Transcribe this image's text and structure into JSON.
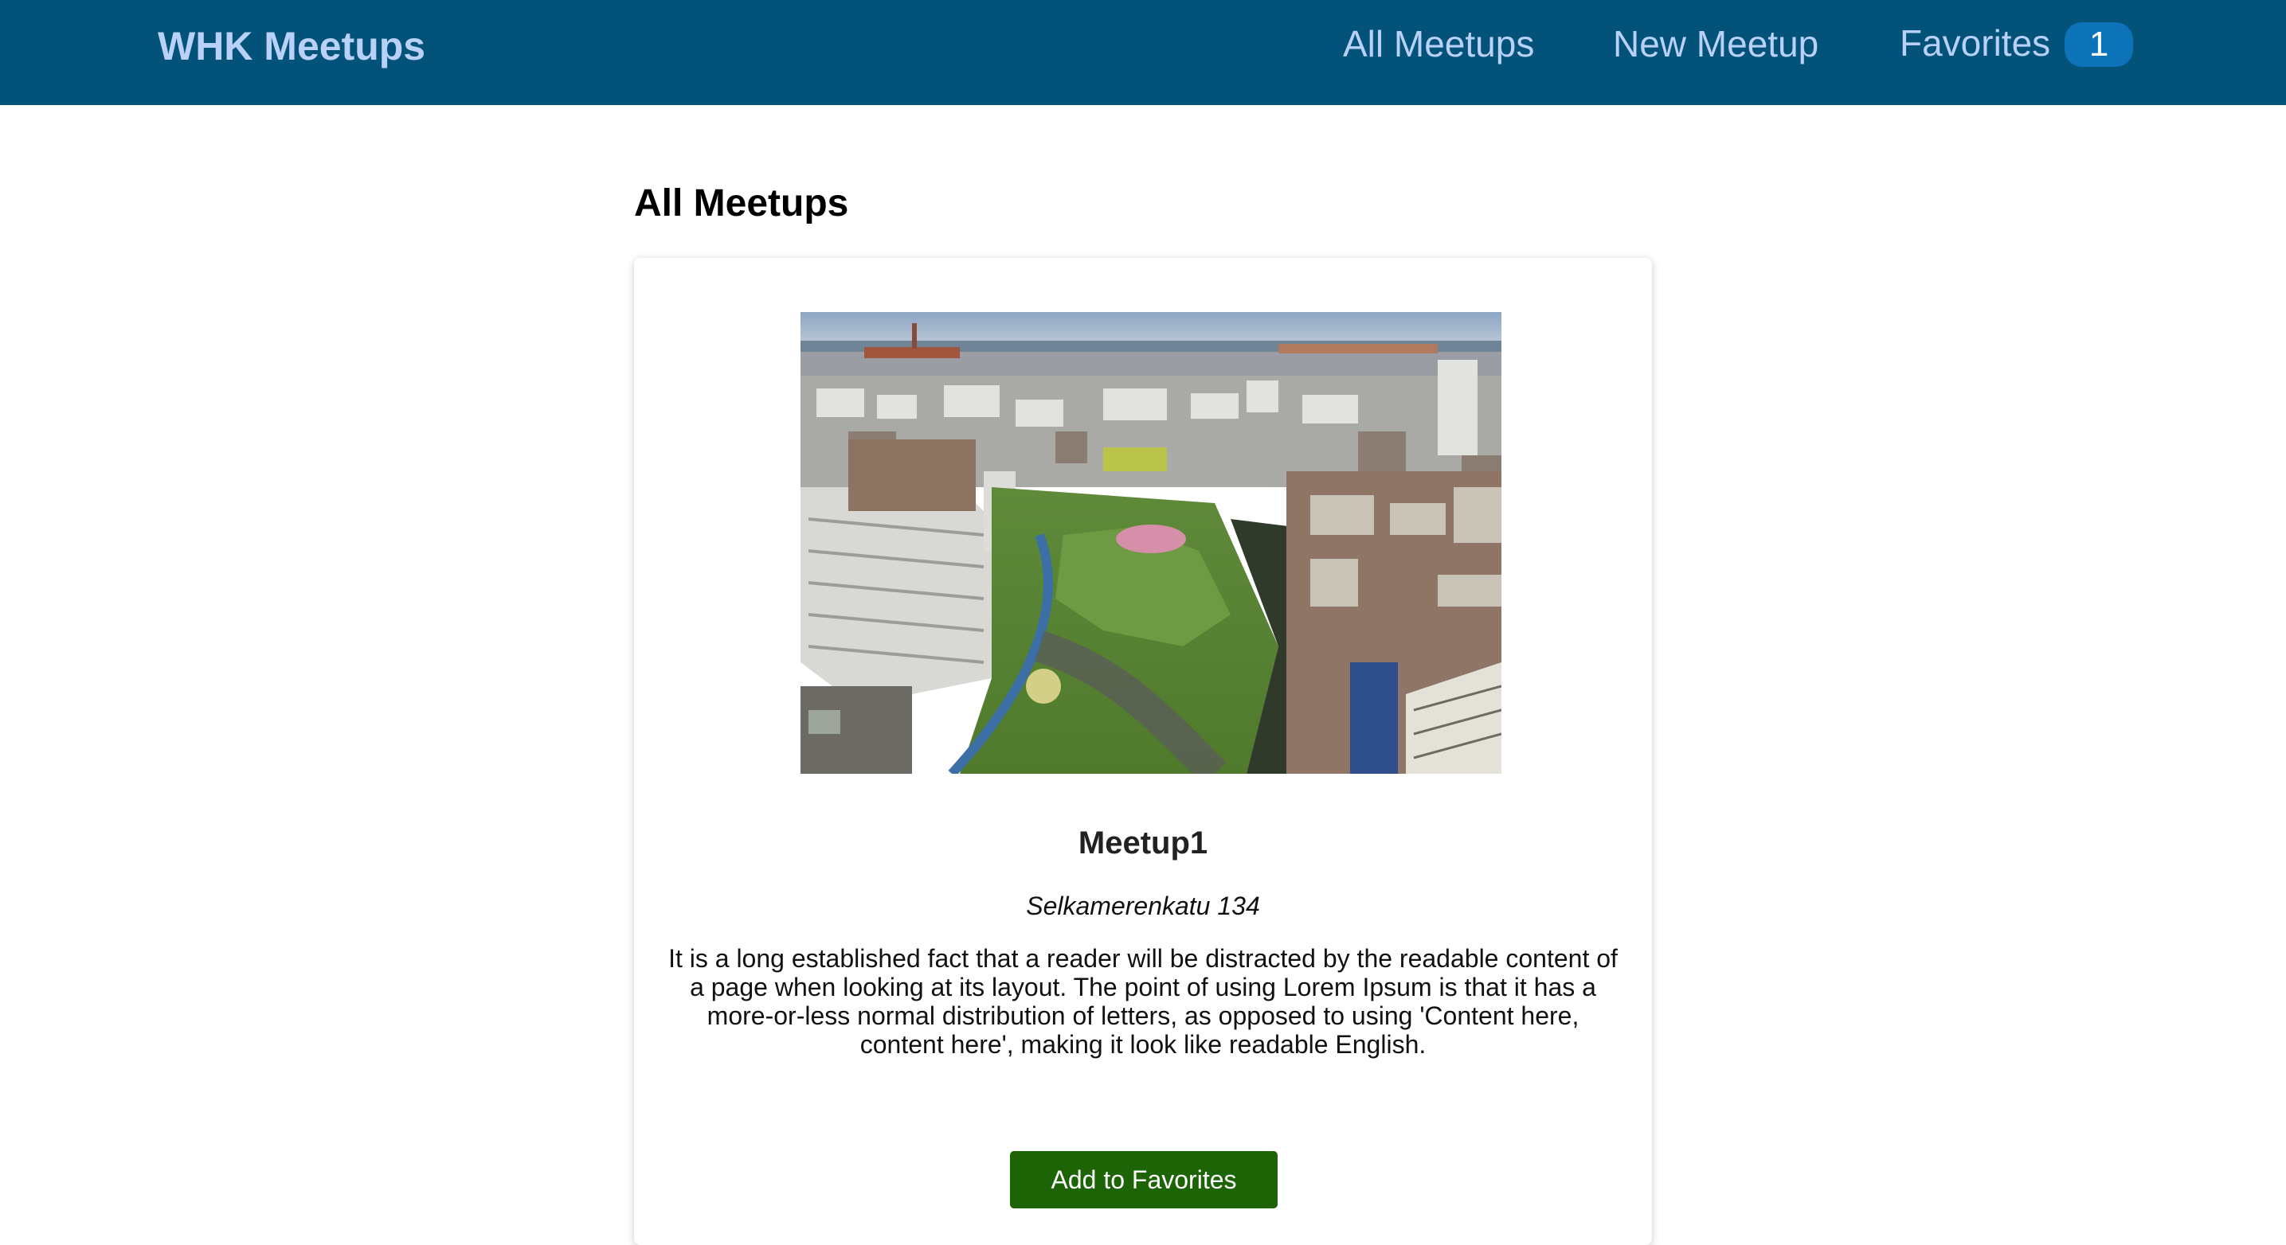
{
  "header": {
    "logo": "WHK Meetups",
    "nav": [
      {
        "label": "All Meetups"
      },
      {
        "label": "New Meetup"
      },
      {
        "label": "Favorites",
        "badge": "1"
      }
    ]
  },
  "main": {
    "title": "All Meetups",
    "meetups": [
      {
        "image_alt": "Aerial view of city district with buildings and a park",
        "title": "Meetup1",
        "address": "Selkamerenkatu 134",
        "description": "It is a long established fact that a reader will be distracted by the readable content of a page when looking at its layout. The point of using Lorem Ipsum is that it has a more-or-less normal distribution of letters, as opposed to using 'Content here, content here', making it look like readable English.",
        "button_label": "Add to Favorites"
      }
    ]
  },
  "colors": {
    "header_bg": "#03527a",
    "nav_text": "#b9d0f7",
    "badge_bg": "#0c73b8",
    "button_bg": "#1d6406"
  }
}
